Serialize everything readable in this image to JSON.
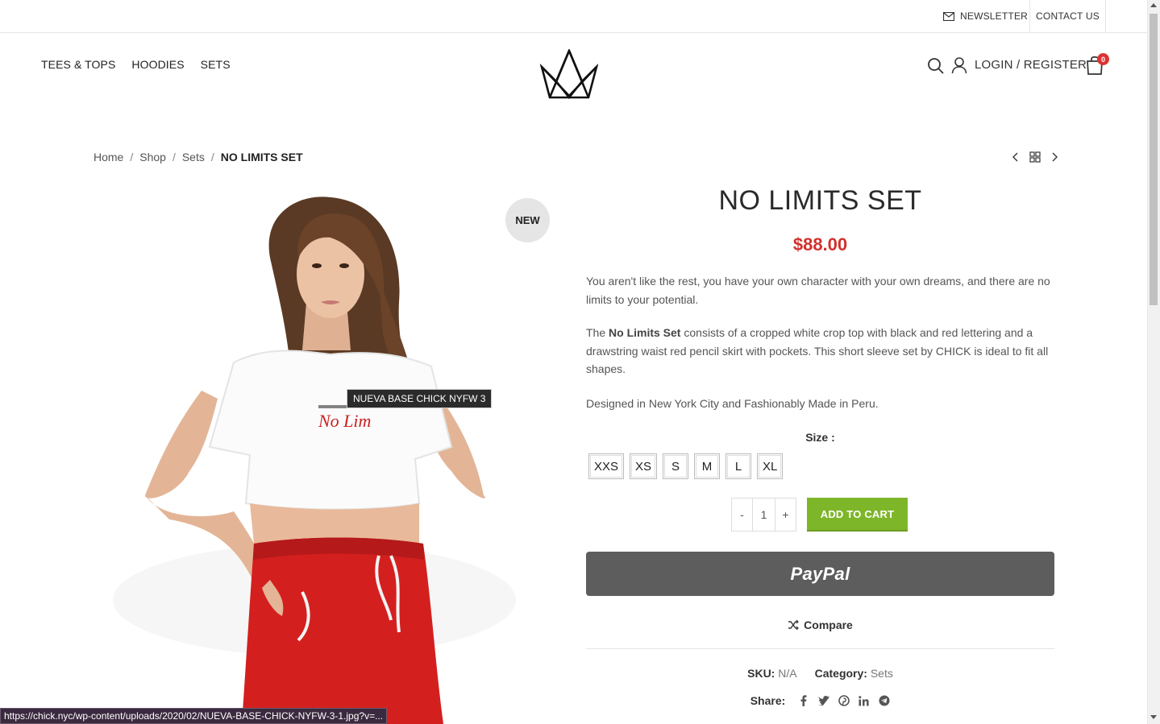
{
  "topbar": {
    "newsletter": "NEWSLETTER",
    "contact": "CONTACT US"
  },
  "nav": {
    "items": [
      "TEES & TOPS",
      "HOODIES",
      "SETS"
    ]
  },
  "header": {
    "login": "LOGIN / REGISTER",
    "cart_count": "0"
  },
  "breadcrumb": {
    "home": "Home",
    "shop": "Shop",
    "sets": "Sets",
    "current": "NO LIMITS SET",
    "separator": "/"
  },
  "product": {
    "badge": "NEW",
    "image_tooltip": "NUEVA BASE CHICK NYFW 3",
    "title": "NO LIMITS SET",
    "price": "$88.00",
    "desc_1": "You aren't like the rest, you have your own character with your own dreams, and there are no limits to your potential.",
    "desc_2_prefix": "The ",
    "desc_2_bold": "No Limits Set",
    "desc_2_rest": " consists of a cropped white crop top with black and red lettering and a drawstring waist red pencil skirt with pockets. This short sleeve set by CHICK is ideal to fit all shapes.",
    "desc_3": "Designed in New York City and Fashionably Made in Peru.",
    "size_label": "Size :",
    "sizes": [
      "XXS",
      "XS",
      "S",
      "M",
      "L",
      "XL"
    ],
    "qty_minus": "-",
    "qty_value": "1",
    "qty_plus": "+",
    "add_to_cart": "ADD TO CART",
    "paypal": "PayPal",
    "compare": "Compare",
    "sku_label": "SKU:",
    "sku_value": "N/A",
    "category_label": "Category:",
    "category_value": "Sets",
    "share_label": "Share:"
  },
  "status_url": "https://chick.nyc/wp-content/uploads/2020/02/NUEVA-BASE-CHICK-NYFW-3-1.jpg?v=...",
  "colors": {
    "price": "#d0312d",
    "add_to_cart": "#7eb62a",
    "paypal": "#5d5d5d",
    "cart_badge": "#dd3333"
  }
}
